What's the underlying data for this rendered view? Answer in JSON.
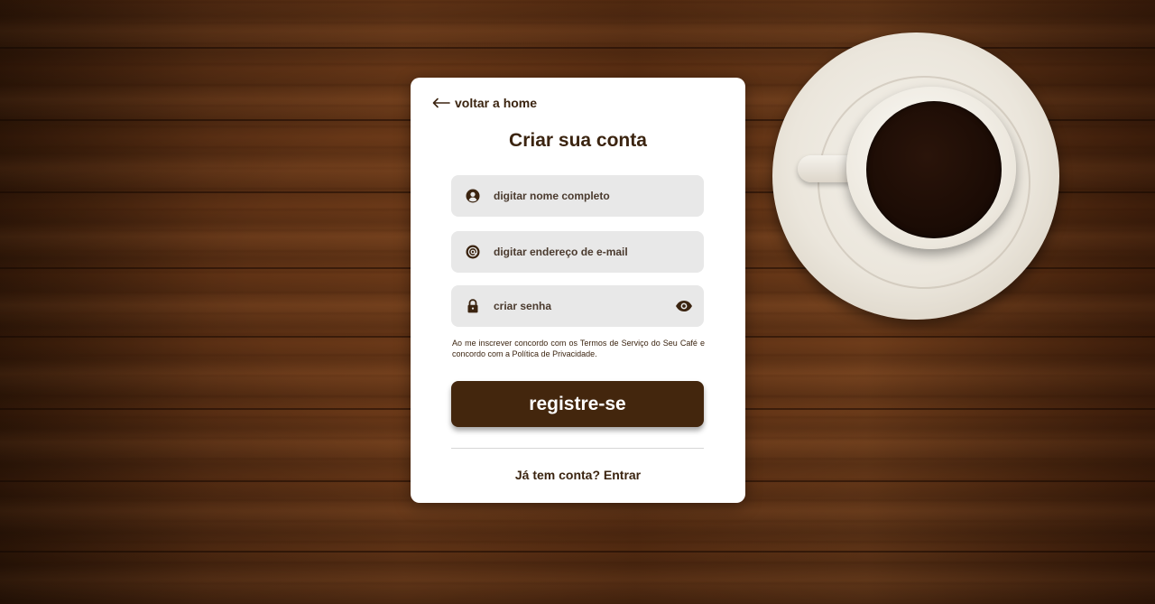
{
  "card": {
    "back_label": "voltar a home",
    "title": "Criar sua conta",
    "fields": {
      "name_placeholder": "digitar nome completo",
      "email_placeholder": "digitar endereço de e-mail",
      "password_placeholder": "criar senha"
    },
    "terms": {
      "prefix": "Ao me inscrever concordo com os ",
      "terms_link": "Termos de Serviço",
      "middle": " do Seu Café e concordo com a ",
      "privacy_link": "Política de Privacidade",
      "suffix": "."
    },
    "register_label": "registre-se",
    "login_label": "Já tem conta? Entrar"
  },
  "icons": {
    "back": "arrow-left-icon",
    "name": "user-icon",
    "email": "at-sign-icon",
    "password": "lock-icon",
    "toggle_password": "eye-icon"
  },
  "colors": {
    "brand_brown": "#43260d",
    "text_brown": "#3b2410",
    "field_bg": "#e8e8e8",
    "card_bg": "#ffffff"
  }
}
